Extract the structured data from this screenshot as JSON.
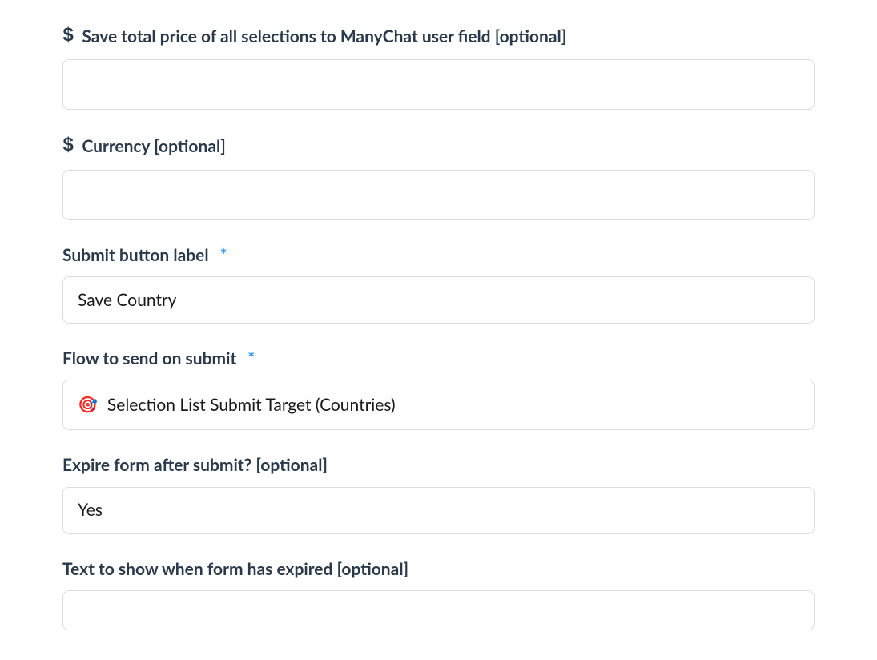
{
  "fields": {
    "savePrice": {
      "label": "Save total price of all selections to ManyChat user field [optional]",
      "value": ""
    },
    "currency": {
      "label": "Currency [optional]",
      "value": ""
    },
    "submitLabel": {
      "label": "Submit button label",
      "value": "Save Country",
      "required": "*"
    },
    "flow": {
      "label": "Flow to send on submit",
      "value": "Selection List Submit Target (Countries)",
      "required": "*",
      "icon": "🎯"
    },
    "expire": {
      "label": "Expire form after submit? [optional]",
      "value": "Yes"
    },
    "expiredText": {
      "label": "Text to show when form has expired [optional]",
      "value": ""
    }
  }
}
